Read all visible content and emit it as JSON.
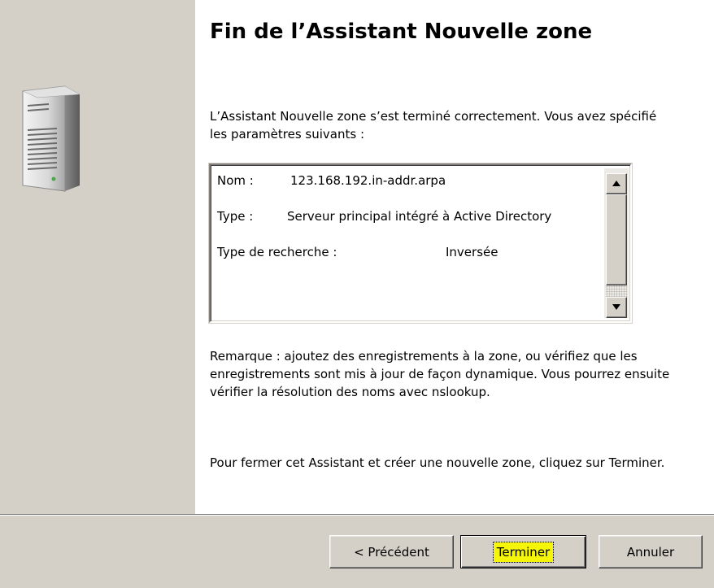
{
  "wizard": {
    "title": "Fin de l’Assistant Nouvelle zone",
    "intro": "L’Assistant Nouvelle zone s’est terminé correctement. Vous avez spécifié les paramètres suivants :",
    "summary": {
      "nom_label": "Nom :",
      "nom_value": "123.168.192.in-addr.arpa",
      "type_label": "Type :",
      "type_value": "Serveur principal intégré à Active Directory",
      "recherche_label": "Type de recherche :",
      "recherche_value": "Inversée"
    },
    "note": "Remarque : ajoutez des enregistrements à la zone, ou vérifiez que les enregistrements sont mis à jour de façon dynamique. Vous pourrez ensuite vérifier la résolution des noms avec nslookup.",
    "close_hint": "Pour fermer cet Assistant et créer une nouvelle zone, cliquez sur Terminer."
  },
  "buttons": {
    "previous": "< Précédent",
    "finish": "Terminer",
    "cancel": "Annuler"
  },
  "icons": {
    "wizard_graphic": "server-icon",
    "scroll_up": "arrow-up-icon",
    "scroll_down": "arrow-down-icon"
  },
  "colors": {
    "panel_gray": "#d4d0c8",
    "highlight_yellow": "#f5f50a"
  }
}
